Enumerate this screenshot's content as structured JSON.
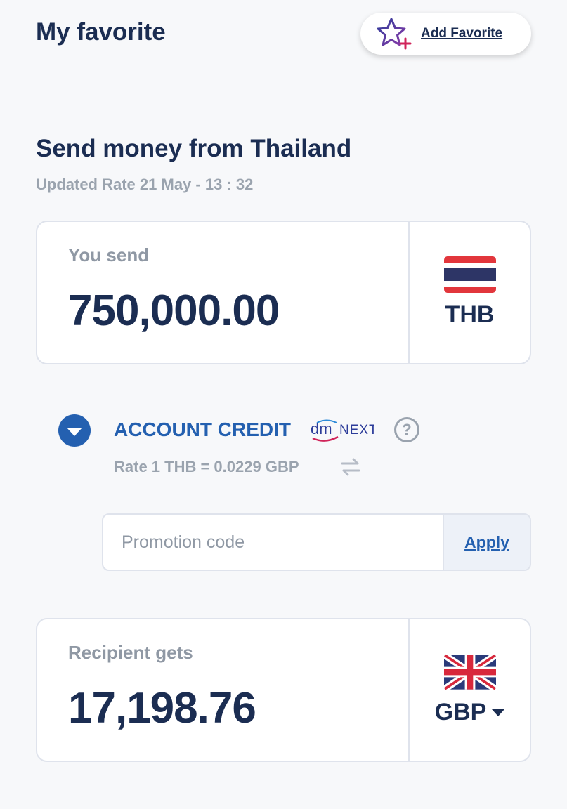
{
  "header": {
    "title": "My favorite",
    "add_favorite_label": "Add Favorite"
  },
  "transfer": {
    "title": "Send money from Thailand",
    "updated_rate": "Updated Rate 21 May - 13 : 32"
  },
  "send": {
    "caption": "You send",
    "amount": "750,000.00",
    "currency": "THB",
    "flag_icon": "thailand-flag-icon"
  },
  "method": {
    "label": "ACCOUNT CREDIT",
    "logo_text": "dmNEXT",
    "help_symbol": "?",
    "rate_text": "Rate 1 THB = 0.0229 GBP"
  },
  "promo": {
    "placeholder": "Promotion code",
    "value": "",
    "apply_label": "Apply"
  },
  "receive": {
    "caption": "Recipient gets",
    "amount": "17,198.76",
    "currency": "GBP",
    "flag_icon": "uk-flag-icon"
  },
  "colors": {
    "primary_navy": "#1b2d52",
    "accent_blue": "#2460b0",
    "muted_gray": "#9aa3ae",
    "background": "#f7f8fa"
  }
}
